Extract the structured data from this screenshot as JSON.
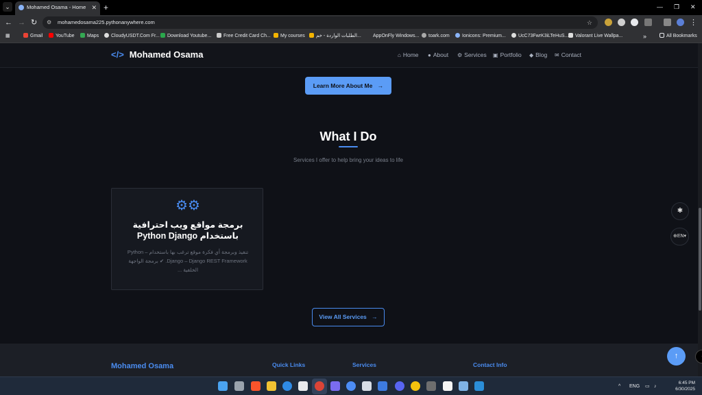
{
  "browser": {
    "tab_title": "Mohamed Osama - Home",
    "tab_close": "✕",
    "new_tab": "+",
    "url": "mohamedosama225.pythonanywhere.com",
    "window_controls": {
      "minimize": "—",
      "restore": "❐",
      "close": "✕"
    }
  },
  "bookmarks": [
    {
      "label": "Gmail",
      "color": "#ea4335"
    },
    {
      "label": "YouTube",
      "color": "#ff0000"
    },
    {
      "label": "Maps",
      "color": "#34a853"
    },
    {
      "label": "CloudyUSDT.Com Fr...",
      "color": "#dddddd"
    },
    {
      "label": "Download Youtube...",
      "color": "#222222"
    },
    {
      "label": "Free Credit Card Ch...",
      "color": "#cccccc"
    },
    {
      "label": "My courses",
      "color": "#f4b400"
    },
    {
      "label": "الطلبات الواردة - خم...",
      "color": "#f4b400"
    },
    {
      "label": "AppOnFly Windows...",
      "color": "#303134"
    },
    {
      "label": "toark.com",
      "color": "#aaaaaa"
    },
    {
      "label": "Ionicons: Premium...",
      "color": "#8ab4f8"
    },
    {
      "label": "UcC73FwrK3iLTeHuS...",
      "color": "#dddddd"
    },
    {
      "label": "Valorant Live Wallpa...",
      "color": "#dddddd"
    }
  ],
  "bookmarks_overflow": "»",
  "all_bookmarks": "All Bookmarks",
  "site": {
    "brand": "Mohamed Osama",
    "brand_icon": "</>",
    "nav": [
      {
        "label": "Home",
        "icon": "⌂"
      },
      {
        "label": "About",
        "icon": "●"
      },
      {
        "label": "Services",
        "icon": "⚙"
      },
      {
        "label": "Portfolio",
        "icon": "▣"
      },
      {
        "label": "Blog",
        "icon": "◆"
      },
      {
        "label": "Contact",
        "icon": "✉"
      }
    ],
    "learn_more": "Learn More About Me",
    "arrow": "→"
  },
  "services": {
    "title": "What I Do",
    "subtitle": "Services I offer to help bring your ideas to life",
    "cards": [
      {
        "icon": "⚙⚙",
        "title": "برمجة مواقع ويب احترافية باستخدام Python Django",
        "description": "تنفيذ وبرمجة أي فكرة موقع ترغب بها باستخدام Python – Django – Django REST Framework. ✔ برمجة الواجهة الخلفية ..."
      }
    ],
    "view_all": "View All Services"
  },
  "footer": {
    "brand": "Mohamed Osama",
    "quick_links": "Quick Links",
    "services": "Services",
    "contact_info": "Contact Info"
  },
  "floating": {
    "settings_icon": "✱",
    "language": "EN",
    "language_icon": "⊕",
    "scroll_top": "↑",
    "edge": "〈"
  },
  "taskbar": {
    "language": "ENG",
    "time": "6:45 PM",
    "date": "6/30/2025",
    "chevron": "^"
  }
}
